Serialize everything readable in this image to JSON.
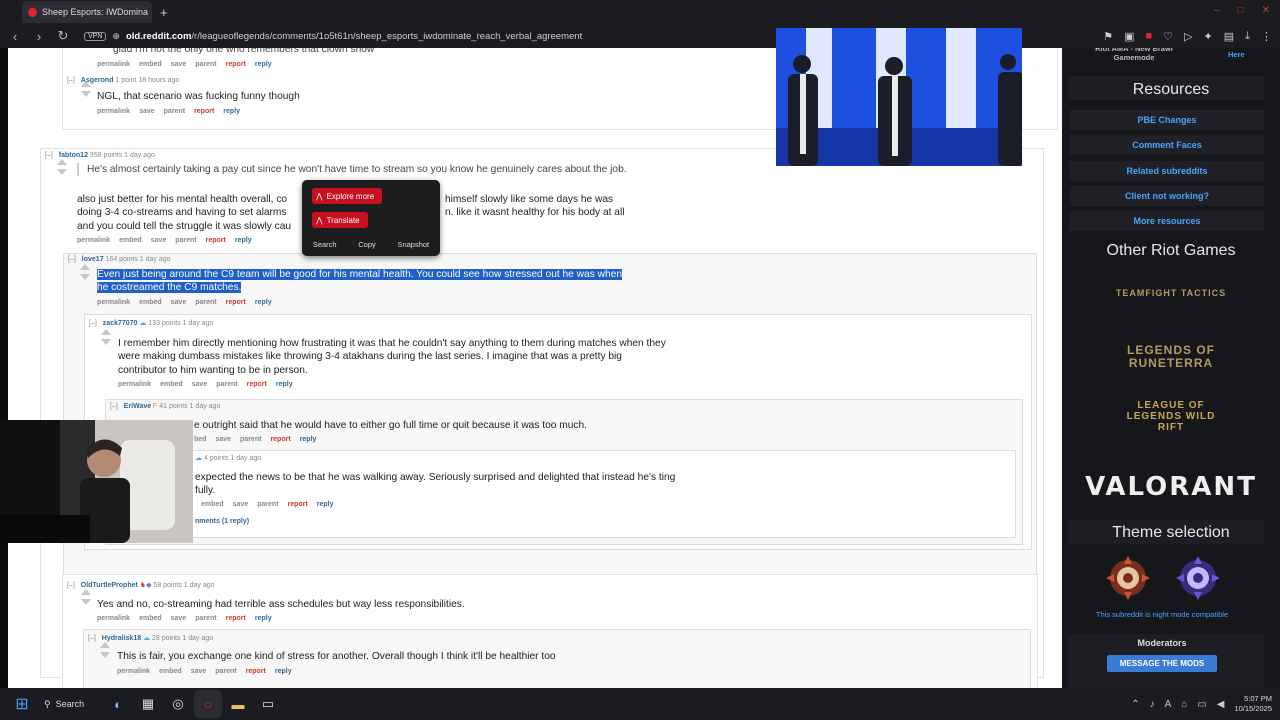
{
  "browser": {
    "tab_title": "Sheep Esports: IWDomina",
    "url_prefix": "old.reddit.com",
    "url_rest": "/r/leagueoflegends/comments/1o5t61n/sheep_esports_iwdominate_reach_verbal_agreement",
    "vpn_label": "VPN",
    "accent_color": "#e0262d"
  },
  "comments": [
    {
      "partial": "glad i'm not the only one who remembers that clown show"
    },
    {
      "author": "Asgerond",
      "meta": "1 point 18 hours ago",
      "body": "NGL, that scenario was fucking funny though"
    },
    {
      "author": "fabton12",
      "meta": "358 points 1 day ago",
      "quote": "He's almost certainly taking a pay cut since he won't have time to stream so you know he genuinely cares about the job.",
      "line1a": "also just better for his mental health overall, co",
      "line1b": "himself slowly like some days he was",
      "line2a": "doing 3-4 co-streams and having to set alarms",
      "line2b": "n. like it wasnt healthy for his body at all",
      "line3": "and you could tell the struggle it was slowly cau"
    },
    {
      "author": "love17",
      "meta": "164 points 1 day ago",
      "body1": "Even just being around the C9 team will be good for his mental health. You could see how stressed out he was when",
      "body2": "he costreamed the C9 matches."
    },
    {
      "author": "zack77070",
      "meta": "133 points 1 day ago",
      "body": "I remember him directly mentioning how frustrating it was that he couldn't say anything to them during matches when they were making dumbass mistakes like throwing 3-4 atakhans during the last series. I imagine that was a pretty big contributor to him wanting to be in person."
    },
    {
      "author": "EriWave",
      "meta": "41 points 1 day ago",
      "body": "e outright said that he would have to either go full time or quit because it was too much."
    },
    {
      "meta": "4 points 1 day ago",
      "body": "expected the news to be that he was walking away. Seriously surprised and delighted that instead he's ting fully.",
      "more": "nments (1 reply)"
    },
    {
      "author": "OldTurtleProphet",
      "meta": "58 points 1 day ago",
      "body": "Yes and no, co-streaming had terrible ass schedules but way less responsibilities."
    },
    {
      "author": "Hydralisk18",
      "meta": "28 points 1 day ago",
      "body": "This is fair, you exchange one kind of stress for another. Overall though I think it'll be healthier too"
    }
  ],
  "buttons": {
    "permalink": "permalink",
    "embed": "embed",
    "save": "save",
    "parent": "parent",
    "report": "report",
    "reply": "reply",
    "collapse": "[–]",
    "bed": "bed"
  },
  "context_menu": {
    "explore": "Explore more",
    "translate": "Translate",
    "search": "Search",
    "copy": "Copy",
    "snapshot": "Snapshot"
  },
  "sidebar": {
    "promo": "Riot AMA - New Brawl Gamemode",
    "promo_link": "Here",
    "resources_title": "Resources",
    "resources": [
      "PBE Changes",
      "Comment Faces",
      "Related subreddits",
      "Client not working?",
      "More resources"
    ],
    "other_games_title": "Other Riot Games",
    "games": [
      "TEAMFIGHT TACTICS",
      "LEGENDS OF RUNETERRA",
      "LEAGUE OF LEGENDS WILD RIFT",
      "VALORANT"
    ],
    "theme_title": "Theme selection",
    "theme_note": "This subreddit is night mode compatible",
    "moderators_title": "Moderators",
    "message_mods": "MESSAGE THE MODS"
  },
  "taskbar": {
    "search": "Search",
    "time": "5:07 PM",
    "date": "10/15/2025"
  }
}
